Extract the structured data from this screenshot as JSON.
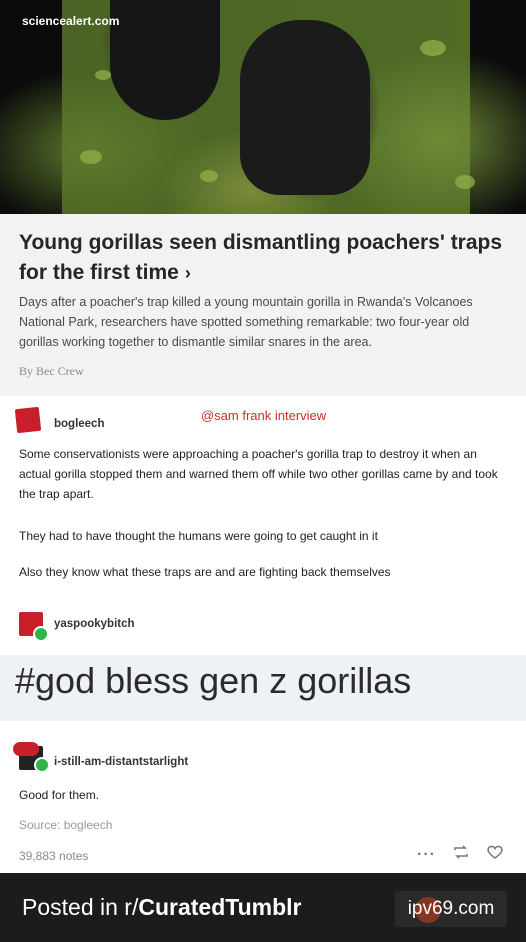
{
  "article": {
    "site": "sciencealert.com",
    "title": "Young gorillas seen dismantling poachers' traps for the first time",
    "chevron": "›",
    "description": "Days after a poacher's trap killed a young mountain gorilla in Rwanda's Volcanoes National Park, researchers have spotted something remarkable: two four-year old gorillas working together to dismantle similar snares in the area.",
    "byline": "By Bec Crew"
  },
  "posts": [
    {
      "username": "bogleech",
      "mention": "@sam frank interview",
      "paragraphs": [
        "Some conservationists were approaching a poacher's gorilla trap to destroy it when an actual gorilla stopped them and warned them off while two other gorillas came by and took the trap apart.",
        "They had to have thought the humans were going to get caught in it",
        "Also they know what these traps are and are fighting back themselves"
      ]
    },
    {
      "username": "yaspookybitch",
      "hashtag": "#god bless gen z gorillas"
    },
    {
      "username": "i-still-am-distantstarlight",
      "text": "Good for them."
    }
  ],
  "meta": {
    "source_label": "Source: bogleech",
    "notes": "39,883 notes",
    "more_icon": "ellipsis-icon",
    "reblog_icon": "reblog-icon",
    "like_icon": "heart-icon"
  },
  "footer": {
    "posted_prefix": "Posted in r/",
    "subreddit": "CuratedTumblr",
    "watermark": "ipv69.com"
  },
  "colors": {
    "mention": "#c9302c",
    "avatar": "#c8202a",
    "badge": "#2fb34a",
    "footer_bg": "#1c1c1c"
  }
}
